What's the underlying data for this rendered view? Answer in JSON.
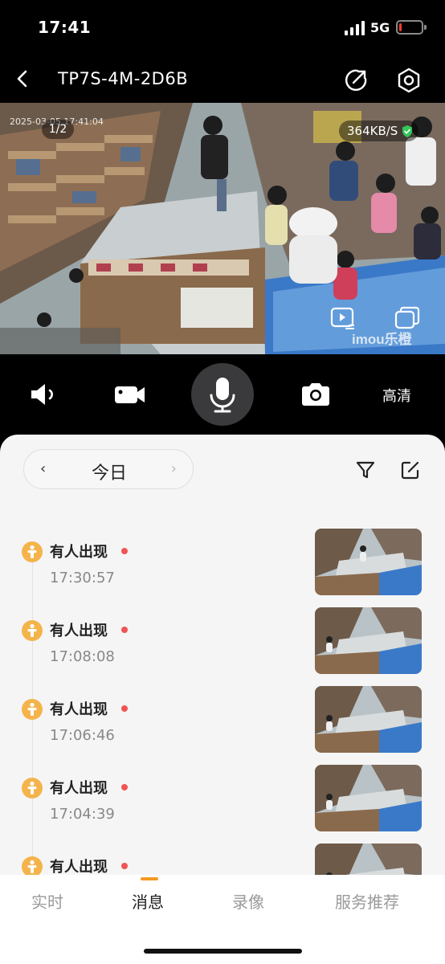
{
  "status_bar": {
    "time": "17:41",
    "network": "5G",
    "battery_level": 0.12
  },
  "nav": {
    "title": "TP7S-4M-2D6B"
  },
  "video": {
    "osd_date": "2025-03-05 17:41:04",
    "page_indicator": "1/2",
    "bitrate": "364KB/S",
    "watermark": "imou乐橙"
  },
  "controls": {
    "hd_label": "高清"
  },
  "date_filter": {
    "label": "今日",
    "prev_icon": "‹",
    "next_icon": "›"
  },
  "events": [
    {
      "title": "有人出现",
      "time": "17:30:57"
    },
    {
      "title": "有人出现",
      "time": "17:08:08"
    },
    {
      "title": "有人出现",
      "time": "17:06:46"
    },
    {
      "title": "有人出现",
      "time": "17:04:39"
    },
    {
      "title": "有人出现",
      "time": ""
    }
  ],
  "tabs": [
    {
      "label": "实时"
    },
    {
      "label": "消息"
    },
    {
      "label": "录像"
    },
    {
      "label": "服务推荐"
    }
  ],
  "colors": {
    "accent": "#f59a23",
    "event_icon": "#f4b44b",
    "unread_dot": "#f05454",
    "secure": "#34c759"
  }
}
